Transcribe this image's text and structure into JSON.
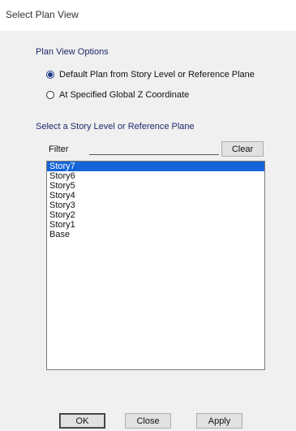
{
  "window": {
    "title": "Select Plan View"
  },
  "plan_view_options": {
    "title": "Plan View Options",
    "options": [
      {
        "label": "Default Plan from Story Level or Reference Plane",
        "checked": true
      },
      {
        "label": "At Specified Global Z Coordinate",
        "checked": false
      }
    ]
  },
  "story_list": {
    "title": "Select a Story Level or Reference Plane",
    "filter_label": "Filter",
    "filter_value": "",
    "clear_label": "Clear",
    "items": [
      "Story7",
      "Story6",
      "Story5",
      "Story4",
      "Story3",
      "Story2",
      "Story1",
      "Base"
    ],
    "selected": "Story7"
  },
  "buttons": {
    "ok": "OK",
    "close": "Close",
    "apply": "Apply"
  },
  "colors": {
    "selection": "#1565d8",
    "section_title": "#1f2a6b",
    "radio_checked": "#1e3a8a"
  }
}
